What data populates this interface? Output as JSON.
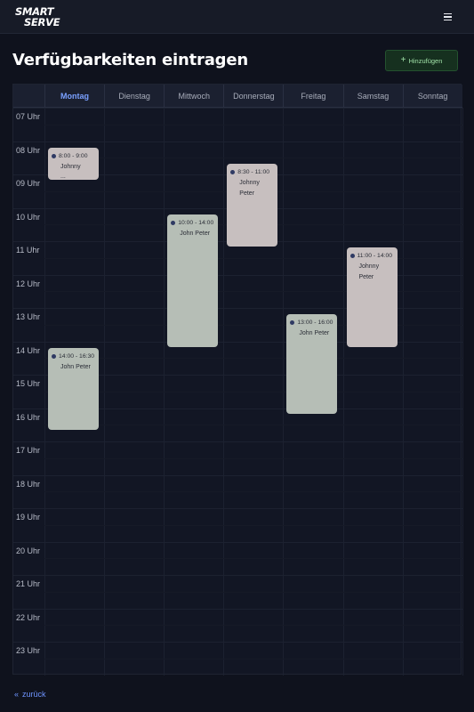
{
  "header": {
    "logo_line1": "SMART",
    "logo_line2": "SERVE",
    "menu_icon": "hamburger-icon"
  },
  "page": {
    "title": "Verfügbarkeiten eintragen",
    "add_button": "Hinzufügen",
    "add_icon": "plus-icon",
    "back_link": "zurück",
    "back_icon": "double-chevron-left-icon"
  },
  "calendar": {
    "days": [
      "Montag",
      "Dienstag",
      "Mittwoch",
      "Donnerstag",
      "Freitag",
      "Samstag",
      "Sonntag"
    ],
    "active_day": "Montag",
    "hours": [
      "07 Uhr",
      "08 Uhr",
      "09 Uhr",
      "10 Uhr",
      "11 Uhr",
      "12 Uhr",
      "13 Uhr",
      "14 Uhr",
      "15 Uhr",
      "16 Uhr",
      "17 Uhr",
      "18 Uhr",
      "19 Uhr",
      "20 Uhr",
      "21 Uhr",
      "22 Uhr",
      "23 Uhr"
    ],
    "events": [
      {
        "day": "Montag",
        "time": "8:00 - 9:00",
        "names": [
          "Johnny",
          "..."
        ],
        "color": "#c7bfbf"
      },
      {
        "day": "Montag",
        "time": "14:00 - 16:30",
        "names": [
          "John Peter"
        ],
        "color": "#b6beb6"
      },
      {
        "day": "Mittwoch",
        "time": "10:00 - 14:00",
        "names": [
          "John Peter"
        ],
        "color": "#b6beb6"
      },
      {
        "day": "Donnerstag",
        "time": "8:30 - 11:00",
        "names": [
          "Johnny",
          "Peter"
        ],
        "color": "#c7bfbf"
      },
      {
        "day": "Freitag",
        "time": "13:00 - 16:00",
        "names": [
          "John Peter"
        ],
        "color": "#b6beb6"
      },
      {
        "day": "Samstag",
        "time": "11:00 - 14:00",
        "names": [
          "Johnny",
          "Peter"
        ],
        "color": "#c7bfbf"
      }
    ]
  },
  "colors": {
    "background": "#0f121d",
    "accent_blue": "#7aa0ff",
    "add_button_bg": "#16301f",
    "add_button_text": "#9fe0a6"
  }
}
